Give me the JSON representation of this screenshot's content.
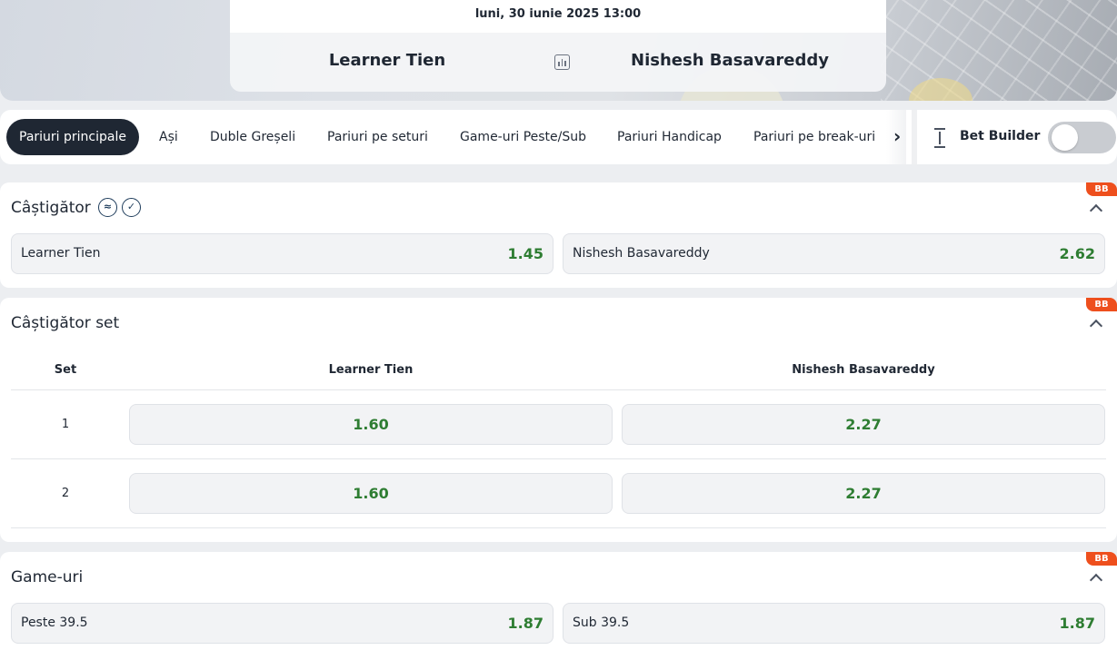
{
  "match": {
    "datetime": "luni, 30 iunie 2025 13:00",
    "home": "Learner Tien",
    "away": "Nishesh Basavareddy",
    "stats_icon": "stats-icon"
  },
  "tabs": [
    {
      "label": "Pariuri principale",
      "active": true
    },
    {
      "label": "Ași"
    },
    {
      "label": "Duble Greșeli"
    },
    {
      "label": "Pariuri pe seturi"
    },
    {
      "label": "Game-uri Peste/Sub"
    },
    {
      "label": "Pariuri Handicap"
    },
    {
      "label": "Pariuri pe break-uri"
    }
  ],
  "bet_builder": {
    "label": "Bet Builder",
    "enabled": false
  },
  "markets": {
    "winner": {
      "title": "Câștigător",
      "badge": "BB",
      "outcomes": [
        {
          "label": "Learner Tien",
          "odd": "1.45"
        },
        {
          "label": "Nishesh Basavareddy",
          "odd": "2.62"
        }
      ]
    },
    "set_winner": {
      "title": "Câștigător set",
      "badge": "BB",
      "headers": {
        "set": "Set",
        "home": "Learner Tien",
        "away": "Nishesh Basavareddy"
      },
      "rows": [
        {
          "set": "1",
          "home": "1.60",
          "away": "2.27"
        },
        {
          "set": "2",
          "home": "1.60",
          "away": "2.27"
        }
      ]
    },
    "games": {
      "title": "Game-uri",
      "badge": "BB",
      "outcomes": [
        {
          "label": "Peste 39.5",
          "odd": "1.87"
        },
        {
          "label": "Sub 39.5",
          "odd": "1.87"
        }
      ]
    }
  },
  "colors": {
    "odd_green": "#2e7d32",
    "active_tab_bg": "#1f2733",
    "bb_badge": "#ee4f1d"
  }
}
